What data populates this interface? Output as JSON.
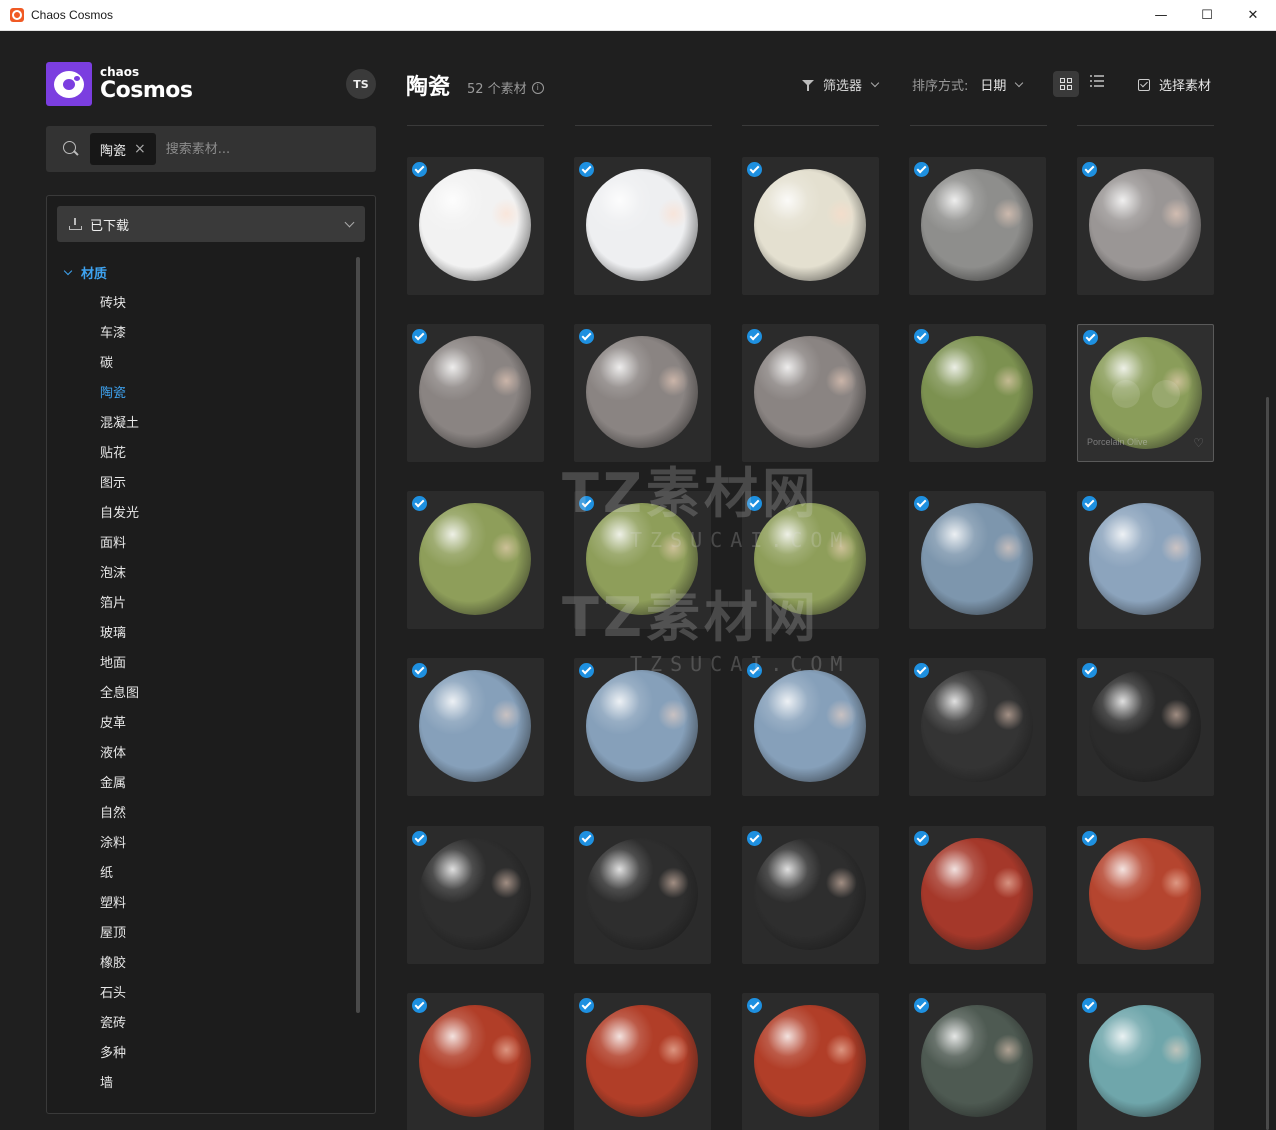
{
  "window": {
    "title": "Chaos Cosmos",
    "controls": {
      "minimize": "—",
      "maximize": "☐",
      "close": "✕"
    }
  },
  "sidebar": {
    "logo_small": "chaos",
    "logo_big": "Cosmos",
    "avatar": "TS",
    "search": {
      "tag": "陶瓷",
      "placeholder": "搜索素材..."
    },
    "downloaded_label": "已下载",
    "category_header": "材质",
    "categories": [
      {
        "label": "砖块",
        "active": false
      },
      {
        "label": "车漆",
        "active": false
      },
      {
        "label": "碳",
        "active": false
      },
      {
        "label": "陶瓷",
        "active": true
      },
      {
        "label": "混凝土",
        "active": false
      },
      {
        "label": "贴花",
        "active": false
      },
      {
        "label": "图示",
        "active": false
      },
      {
        "label": "自发光",
        "active": false
      },
      {
        "label": "面料",
        "active": false
      },
      {
        "label": "泡沫",
        "active": false
      },
      {
        "label": "箔片",
        "active": false
      },
      {
        "label": "玻璃",
        "active": false
      },
      {
        "label": "地面",
        "active": false
      },
      {
        "label": "全息图",
        "active": false
      },
      {
        "label": "皮革",
        "active": false
      },
      {
        "label": "液体",
        "active": false
      },
      {
        "label": "金属",
        "active": false
      },
      {
        "label": "自然",
        "active": false
      },
      {
        "label": "涂料",
        "active": false
      },
      {
        "label": "纸",
        "active": false
      },
      {
        "label": "塑料",
        "active": false
      },
      {
        "label": "屋顶",
        "active": false
      },
      {
        "label": "橡胶",
        "active": false
      },
      {
        "label": "石头",
        "active": false
      },
      {
        "label": "瓷砖",
        "active": false
      },
      {
        "label": "多种",
        "active": false
      },
      {
        "label": "墙",
        "active": false
      }
    ]
  },
  "header": {
    "title": "陶瓷",
    "count": "52 个素材",
    "filter_label": "筛选器",
    "sort_label": "排序方式:",
    "sort_value": "日期",
    "select_label": "选择素材"
  },
  "assets": [
    {
      "color": "#f2f2f2",
      "checked": true
    },
    {
      "color": "#eeeff1",
      "checked": true
    },
    {
      "color": "#e4e0d0",
      "checked": true
    },
    {
      "color": "#8e8e8c",
      "checked": true
    },
    {
      "color": "#9a9695",
      "checked": true
    },
    {
      "color": "#8a8482",
      "checked": true
    },
    {
      "color": "#8a8482",
      "checked": true
    },
    {
      "color": "#8a8482",
      "checked": true
    },
    {
      "color": "#7c9150",
      "checked": true
    },
    {
      "color": "#8a9d5a",
      "checked": true,
      "hover": true,
      "name": "Porcelain Olive"
    },
    {
      "color": "#8e9e5a",
      "checked": true
    },
    {
      "color": "#8e9e5a",
      "checked": true
    },
    {
      "color": "#8e9e5a",
      "checked": true
    },
    {
      "color": "#7d96ad",
      "checked": true
    },
    {
      "color": "#8ca4bd",
      "checked": true
    },
    {
      "color": "#86a0ba",
      "checked": true
    },
    {
      "color": "#86a0ba",
      "checked": true
    },
    {
      "color": "#86a0ba",
      "checked": true
    },
    {
      "color": "#343434",
      "checked": true
    },
    {
      "color": "#2b2b2b",
      "checked": true
    },
    {
      "color": "#2e2e2e",
      "checked": true
    },
    {
      "color": "#2e2e2e",
      "checked": true
    },
    {
      "color": "#2e2e2e",
      "checked": true
    },
    {
      "color": "#a5382a",
      "checked": true
    },
    {
      "color": "#b5452f",
      "checked": true
    },
    {
      "color": "#b13e28",
      "checked": true
    },
    {
      "color": "#b13e28",
      "checked": true
    },
    {
      "color": "#b13e28",
      "checked": true
    },
    {
      "color": "#4e5a52",
      "checked": true
    },
    {
      "color": "#6fa6ab",
      "checked": true
    }
  ],
  "watermark": {
    "title": "TZ素材网",
    "sub": "TZSUCAI.COM"
  }
}
